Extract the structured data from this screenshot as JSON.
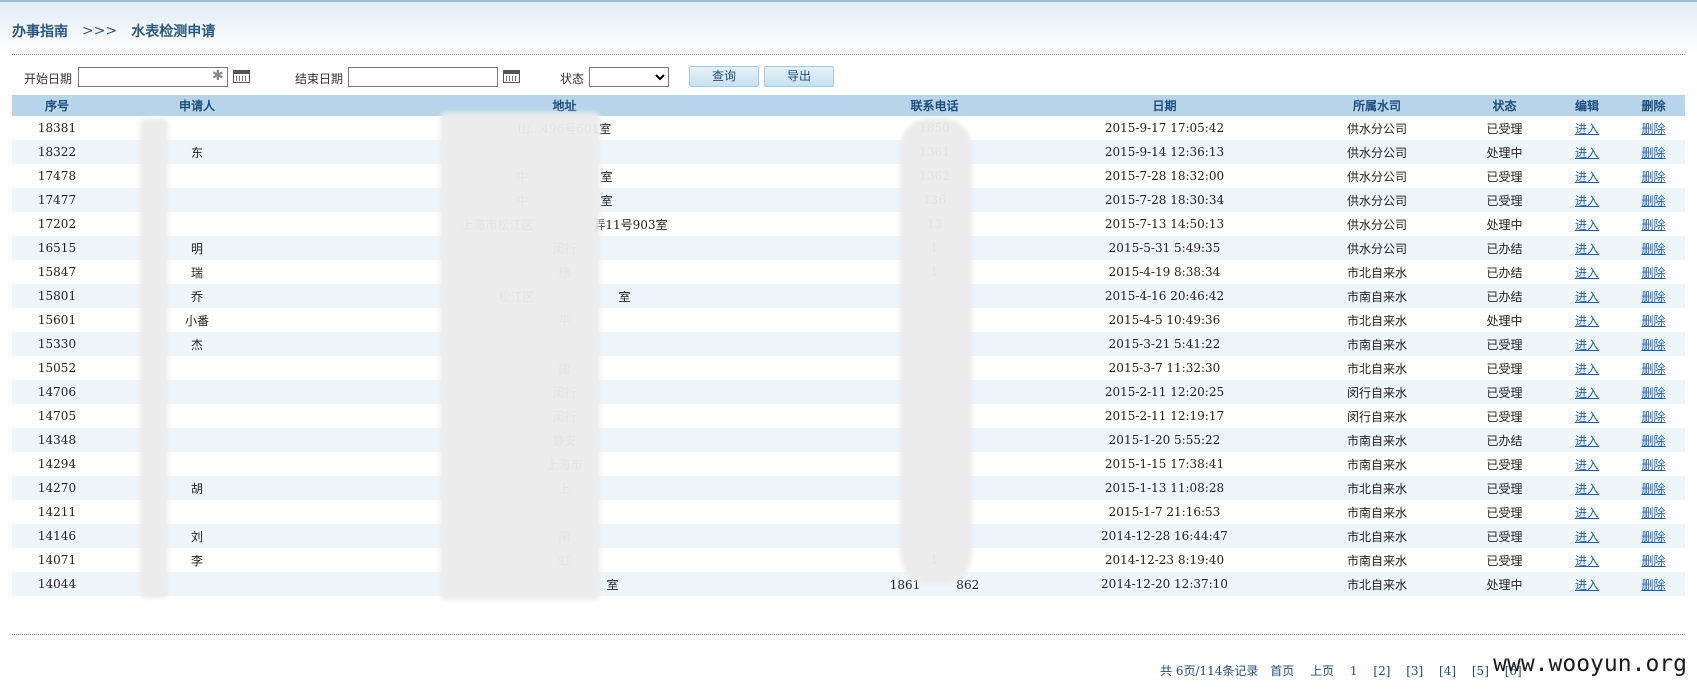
{
  "breadcrumb": {
    "root": "办事指南",
    "separator": ">>>",
    "current": "水表检测申请"
  },
  "filters": {
    "start_label": "开始日期",
    "start_value": "",
    "end_label": "结束日期",
    "end_value": "",
    "status_label": "状态",
    "status_selected": "",
    "query_button": "查询",
    "export_button": "导出"
  },
  "table": {
    "headers": [
      "序号",
      "申请人",
      "地址",
      "联系电话",
      "日期",
      "所属水司",
      "状态",
      "编辑",
      "删除"
    ],
    "rows": [
      {
        "id": "18381",
        "name": "",
        "addr": "山...496号601室",
        "phone": "1850",
        "date": "2015-9-17 17:05:42",
        "company": "供水分公司",
        "status": "已受理",
        "edit": "进入",
        "del": "删除"
      },
      {
        "id": "18322",
        "name": "东",
        "addr": "",
        "phone": "1361",
        "date": "2015-9-14 12:36:13",
        "company": "供水分公司",
        "status": "处理中",
        "edit": "进入",
        "del": "删除"
      },
      {
        "id": "17478",
        "name": "",
        "addr": "中　　　　　　室",
        "phone": "1362",
        "date": "2015-7-28 18:32:00",
        "company": "供水分公司",
        "status": "已受理",
        "edit": "进入",
        "del": "删除"
      },
      {
        "id": "17477",
        "name": "",
        "addr": "中　　　　　　室",
        "phone": "136",
        "date": "2015-7-28 18:30:34",
        "company": "供水分公司",
        "status": "已受理",
        "edit": "进入",
        "del": "删除"
      },
      {
        "id": "17202",
        "name": "",
        "addr": "上海市松江区　　　　　弄11号903室",
        "phone": "13",
        "date": "2015-7-13 14:50:13",
        "company": "供水分公司",
        "status": "处理中",
        "edit": "进入",
        "del": "删除"
      },
      {
        "id": "16515",
        "name": "明",
        "addr": "闵行",
        "phone": "1",
        "date": "2015-5-31 5:49:35",
        "company": "供水分公司",
        "status": "已办结",
        "edit": "进入",
        "del": "删除"
      },
      {
        "id": "15847",
        "name": "瑞",
        "addr": "杨",
        "phone": "1",
        "date": "2015-4-19 8:38:34",
        "company": "市北自来水",
        "status": "已办结",
        "edit": "进入",
        "del": "删除"
      },
      {
        "id": "15801",
        "name": "乔",
        "addr": "松江区　　　　　　　室",
        "phone": "",
        "date": "2015-4-16 20:46:42",
        "company": "市南自来水",
        "status": "已办结",
        "edit": "进入",
        "del": "删除"
      },
      {
        "id": "15601",
        "name": "小番",
        "addr": "平",
        "phone": "",
        "date": "2015-4-5 10:49:36",
        "company": "市北自来水",
        "status": "处理中",
        "edit": "进入",
        "del": "删除"
      },
      {
        "id": "15330",
        "name": "杰",
        "addr": "",
        "phone": "",
        "date": "2015-3-21 5:41:22",
        "company": "市南自来水",
        "status": "已受理",
        "edit": "进入",
        "del": "删除"
      },
      {
        "id": "15052",
        "name": "",
        "addr": "国",
        "phone": "",
        "date": "2015-3-7 11:32:30",
        "company": "市北自来水",
        "status": "已受理",
        "edit": "进入",
        "del": "删除"
      },
      {
        "id": "14706",
        "name": "",
        "addr": "闵行",
        "phone": "",
        "date": "2015-2-11 12:20:25",
        "company": "闵行自来水",
        "status": "已受理",
        "edit": "进入",
        "del": "删除"
      },
      {
        "id": "14705",
        "name": "",
        "addr": "闵行",
        "phone": "",
        "date": "2015-2-11 12:19:17",
        "company": "闵行自来水",
        "status": "已受理",
        "edit": "进入",
        "del": "删除"
      },
      {
        "id": "14348",
        "name": "",
        "addr": "静安",
        "phone": "",
        "date": "2015-1-20 5:55:22",
        "company": "市南自来水",
        "status": "已办结",
        "edit": "进入",
        "del": "删除"
      },
      {
        "id": "14294",
        "name": "",
        "addr": "上海市",
        "phone": "",
        "date": "2015-1-15 17:38:41",
        "company": "市南自来水",
        "status": "已受理",
        "edit": "进入",
        "del": "删除"
      },
      {
        "id": "14270",
        "name": "胡",
        "addr": "上",
        "phone": "",
        "date": "2015-1-13 11:08:28",
        "company": "市北自来水",
        "status": "已受理",
        "edit": "进入",
        "del": "删除"
      },
      {
        "id": "14211",
        "name": "",
        "addr": "",
        "phone": "",
        "date": "2015-1-7 21:16:53",
        "company": "市南自来水",
        "status": "已受理",
        "edit": "进入",
        "del": "删除"
      },
      {
        "id": "14146",
        "name": "刘",
        "addr": "闸",
        "phone": "",
        "date": "2014-12-28 16:44:47",
        "company": "市北自来水",
        "status": "已受理",
        "edit": "进入",
        "del": "删除"
      },
      {
        "id": "14071",
        "name": "李",
        "addr": "虹",
        "phone": "1",
        "date": "2014-12-23 8:19:40",
        "company": "市南自来水",
        "status": "已受理",
        "edit": "进入",
        "del": "删除"
      },
      {
        "id": "14044",
        "name": "",
        "addr": "　　　　　　　　室",
        "phone": "1861　　　862",
        "date": "2014-12-20 12:37:10",
        "company": "市北自来水",
        "status": "处理中",
        "edit": "进入",
        "del": "删除"
      }
    ]
  },
  "pager": {
    "summary": "共 6页/114条记录",
    "first": "首页",
    "prev": "上页",
    "pages": [
      "1",
      "[2]",
      "[3]",
      "[4]",
      "[5]",
      "[6]"
    ]
  },
  "watermark": "www.wooyun.org"
}
